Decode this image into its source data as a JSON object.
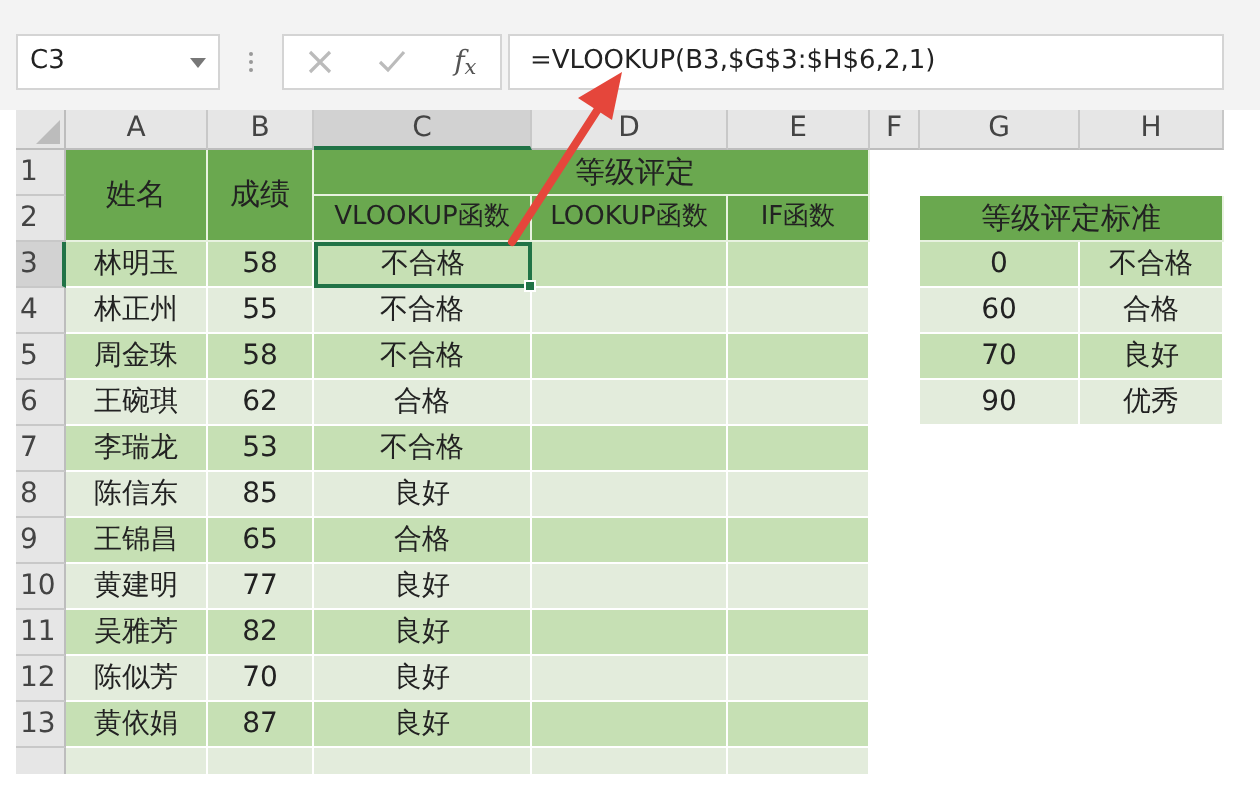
{
  "toolbar": {
    "name_box": "C3",
    "function_label": "f$_{x}$",
    "formula": "=VLOOKUP(B3,$G$3:$H$6,2,1)"
  },
  "column_headers": [
    {
      "label": "A",
      "selected": false
    },
    {
      "label": "B",
      "selected": false
    },
    {
      "label": "C",
      "selected": true
    },
    {
      "label": "D",
      "selected": false
    },
    {
      "label": "E",
      "selected": false
    },
    {
      "label": "F",
      "selected": false
    },
    {
      "label": "G",
      "selected": false
    },
    {
      "label": "H",
      "selected": false
    }
  ],
  "row_numbers": [
    {
      "label": "1",
      "selected": false
    },
    {
      "label": "2",
      "selected": false
    },
    {
      "label": "3",
      "selected": true
    },
    {
      "label": "4",
      "selected": false
    },
    {
      "label": "5",
      "selected": false
    },
    {
      "label": "6",
      "selected": false
    },
    {
      "label": "7",
      "selected": false
    },
    {
      "label": "8",
      "selected": false
    },
    {
      "label": "9",
      "selected": false
    },
    {
      "label": "10",
      "selected": false
    },
    {
      "label": "11",
      "selected": false
    },
    {
      "label": "12",
      "selected": false
    },
    {
      "label": "13",
      "selected": false
    }
  ],
  "main_table": {
    "group_header": "等级评定",
    "headers": [
      "姓名",
      "成绩",
      "VLOOKUP函数",
      "LOOKUP函数",
      "IF函数"
    ],
    "rows": [
      {
        "name": "林明玉",
        "score": "58",
        "vlookup": "不合格",
        "selected": true
      },
      {
        "name": "林正州",
        "score": "55",
        "vlookup": "不合格",
        "selected": false
      },
      {
        "name": "周金珠",
        "score": "58",
        "vlookup": "不合格",
        "selected": false
      },
      {
        "name": "王碗琪",
        "score": "62",
        "vlookup": "合格",
        "selected": false
      },
      {
        "name": "李瑞龙",
        "score": "53",
        "vlookup": "不合格",
        "selected": false
      },
      {
        "name": "陈信东",
        "score": "85",
        "vlookup": "良好",
        "selected": false
      },
      {
        "name": "王锦昌",
        "score": "65",
        "vlookup": "合格",
        "selected": false
      },
      {
        "name": "黄建明",
        "score": "77",
        "vlookup": "良好",
        "selected": false
      },
      {
        "name": "吴雅芳",
        "score": "82",
        "vlookup": "良好",
        "selected": false
      },
      {
        "name": "陈似芳",
        "score": "70",
        "vlookup": "良好",
        "selected": false
      },
      {
        "name": "黄依娟",
        "score": "87",
        "vlookup": "良好",
        "selected": false
      }
    ]
  },
  "standard_table": {
    "title": "等级评定标准",
    "rows": [
      {
        "threshold": "0",
        "grade": "不合格"
      },
      {
        "threshold": "60",
        "grade": "合格"
      },
      {
        "threshold": "70",
        "grade": "良好"
      },
      {
        "threshold": "90",
        "grade": "优秀"
      }
    ]
  }
}
